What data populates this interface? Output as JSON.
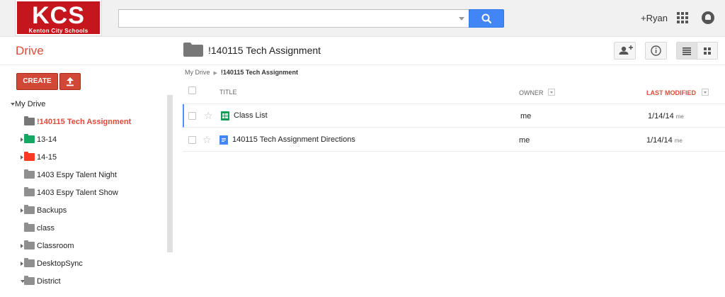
{
  "logo": {
    "title": "KCS",
    "subtitle": "Kenton City Schools"
  },
  "search": {
    "value": "",
    "placeholder": ""
  },
  "user": {
    "name": "+Ryan"
  },
  "app": {
    "name": "Drive"
  },
  "folder": {
    "title": "!140115 Tech Assignment"
  },
  "buttons": {
    "create": "CREATE"
  },
  "breadcrumb": {
    "root": "My Drive",
    "current": "!140115 Tech Assignment"
  },
  "tree": {
    "root": "My Drive",
    "items": [
      {
        "label": "!140115 Tech Assignment",
        "color": "#777777",
        "expandable": false,
        "active": true
      },
      {
        "label": "13-14",
        "color": "#16a765",
        "expandable": true,
        "active": false
      },
      {
        "label": "14-15",
        "color": "#f83a22",
        "expandable": true,
        "active": false
      },
      {
        "label": "1403 Espy Talent Night",
        "color": "#8f8f8f",
        "expandable": false,
        "active": false,
        "shared": true
      },
      {
        "label": "1403 Espy Talent Show",
        "color": "#8f8f8f",
        "expandable": false,
        "active": false
      },
      {
        "label": "Backups",
        "color": "#8f8f8f",
        "expandable": true,
        "active": false
      },
      {
        "label": "class",
        "color": "#8f8f8f",
        "expandable": false,
        "active": false
      },
      {
        "label": "Classroom",
        "color": "#8f8f8f",
        "expandable": true,
        "active": false
      },
      {
        "label": "DesktopSync",
        "color": "#8f8f8f",
        "expandable": true,
        "active": false
      },
      {
        "label": "District",
        "color": "#8f8f8f",
        "expandable": true,
        "expanded": true,
        "active": false
      }
    ]
  },
  "list": {
    "columns": {
      "title": "TITLE",
      "owner": "OWNER",
      "modified": "LAST MODIFIED"
    },
    "files": [
      {
        "name": "Class List",
        "type": "spreadsheet",
        "color": "#0f9d58",
        "owner": "me",
        "modified": "1/14/14",
        "modified_by": "me"
      },
      {
        "name": "140115 Tech Assignment Directions",
        "type": "document",
        "color": "#4285f4",
        "owner": "me",
        "modified": "1/14/14",
        "modified_by": "me"
      }
    ]
  },
  "colors": {
    "accent": "#dd4b39",
    "create_button": "#d14836",
    "search_button": "#4285f4"
  }
}
